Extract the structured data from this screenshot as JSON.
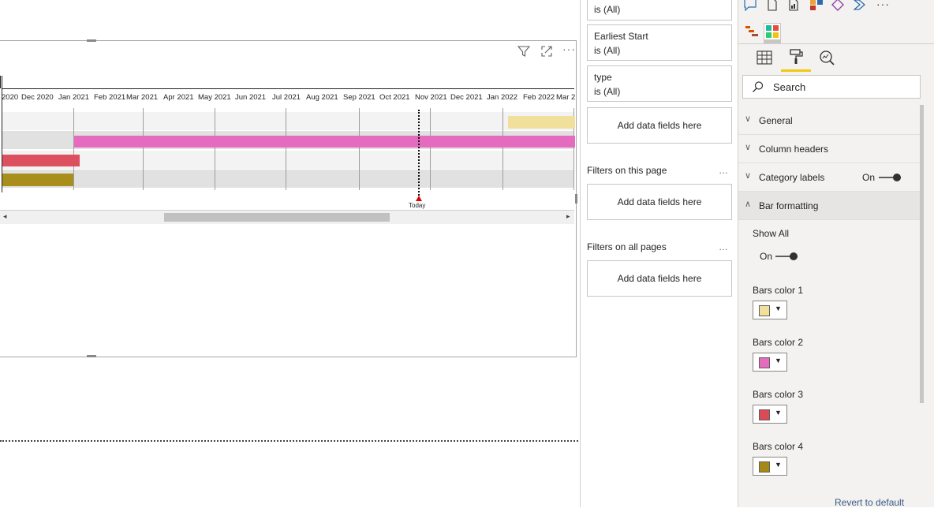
{
  "visual": {
    "months": [
      "2020",
      "Dec 2020",
      "Jan 2021",
      "Feb 2021",
      "Mar 2021",
      "Apr 2021",
      "May 2021",
      "Jun 2021",
      "Jul 2021",
      "Aug 2021",
      "Sep 2021",
      "Oct 2021",
      "Nov 2021",
      "Dec 2021",
      "Jan 2022",
      "Feb 2022",
      "Mar 2"
    ],
    "today_label": "Today",
    "bar_colors": [
      "#f1e09b",
      "#e46bbe",
      "#dc5060",
      "#a88f1b"
    ]
  },
  "filters": {
    "card0_value": "is (All)",
    "card1_title": "Earliest Start",
    "card1_value": "is (All)",
    "card2_title": "type",
    "card2_value": "is (All)",
    "add_fields": "Add data fields here",
    "on_this_page": "Filters on this page",
    "on_all_pages": "Filters on all pages",
    "more": "…"
  },
  "format": {
    "search_placeholder": "Search",
    "sections": {
      "general": "General",
      "column_headers": "Column headers",
      "category_labels": "Category labels",
      "category_labels_state": "On",
      "bar_formatting": "Bar formatting"
    },
    "show_all": "Show All",
    "show_all_state": "On",
    "bars": [
      {
        "label": "Bars color 1",
        "color": "#f1e09b"
      },
      {
        "label": "Bars color 2",
        "color": "#e46bbe"
      },
      {
        "label": "Bars color 3",
        "color": "#dc4a58"
      },
      {
        "label": "Bars color 4",
        "color": "#a48a14"
      }
    ],
    "revert": "Revert to default"
  }
}
